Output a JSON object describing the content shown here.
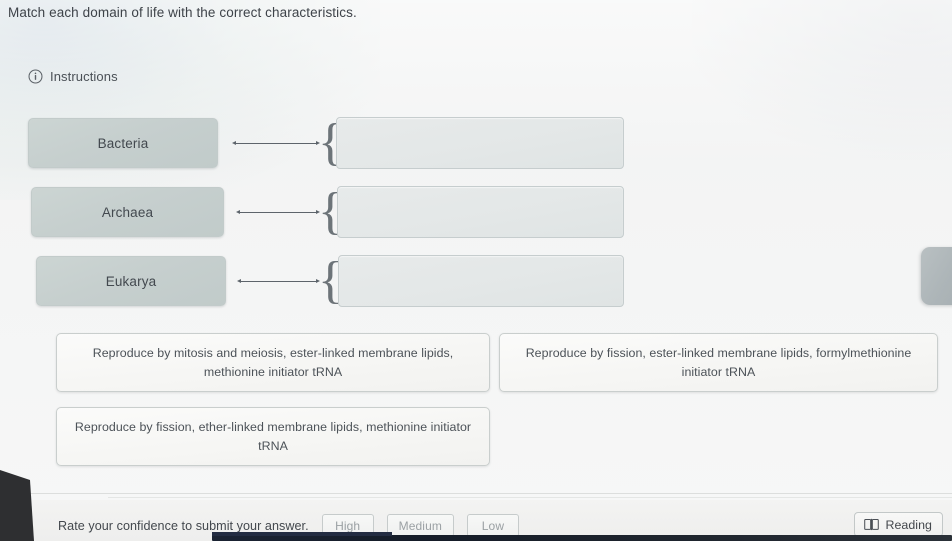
{
  "question": {
    "text": "Match each domain of life with the correct characteristics."
  },
  "instructions": {
    "label": "Instructions",
    "icon": "info-circle-icon"
  },
  "match_rows": [
    {
      "domain": "Bacteria",
      "dropzone_value": "",
      "connector": "double-arrow",
      "brace": "{"
    },
    {
      "domain": "Archaea",
      "dropzone_value": "",
      "connector": "double-arrow",
      "brace": "{"
    },
    {
      "domain": "Eukarya",
      "dropzone_value": "",
      "connector": "double-arrow",
      "brace": "{"
    }
  ],
  "options": [
    {
      "text": "Reproduce by mitosis and meiosis, ester-linked membrane lipids, methionine initiator tRNA"
    },
    {
      "text": "Reproduce by fission, ester-linked membrane lipids, formylmethionine initiator tRNA"
    },
    {
      "text": "Reproduce by fission, ether-linked membrane lipids, methionine initiator tRNA"
    }
  ],
  "bottom_bar": {
    "confidence_prompt": "Rate your confidence to submit your answer.",
    "confidence_options": [
      "High",
      "Medium",
      "Low"
    ],
    "reading_button": {
      "label": "Reading",
      "icon": "book-icon"
    }
  },
  "colors": {
    "page_background": "#f2f3f3",
    "domain_chip": "#c6cfce",
    "dropzone": "#e3e7e7",
    "option_tile": "#f6f6f4",
    "text_primary": "#43494f",
    "text_muted": "#9aa0a3",
    "connector": "#5d646b",
    "side_tab": "#adb5b8"
  }
}
